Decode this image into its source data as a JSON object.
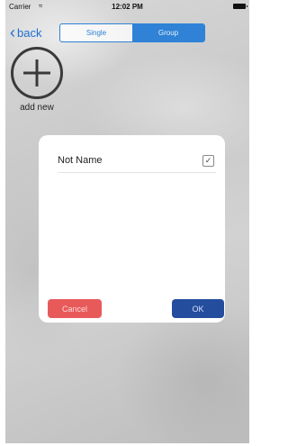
{
  "status_bar": {
    "carrier": "Carrier",
    "wifi_icon": "wifi-icon",
    "time": "12:02 PM",
    "battery_icon": "battery-icon"
  },
  "nav": {
    "back_label": "back",
    "segments": [
      {
        "label": "Single",
        "selected": false
      },
      {
        "label": "Group",
        "selected": true
      }
    ],
    "accent_color": "#2f82d6"
  },
  "add_new": {
    "icon": "plus-circle-icon",
    "label": "add new"
  },
  "dialog": {
    "row_label": "Not Name",
    "row_checked": true,
    "cancel_label": "Cancel",
    "ok_label": "OK",
    "cancel_color": "#e85a5a",
    "ok_color": "#244d9e"
  }
}
